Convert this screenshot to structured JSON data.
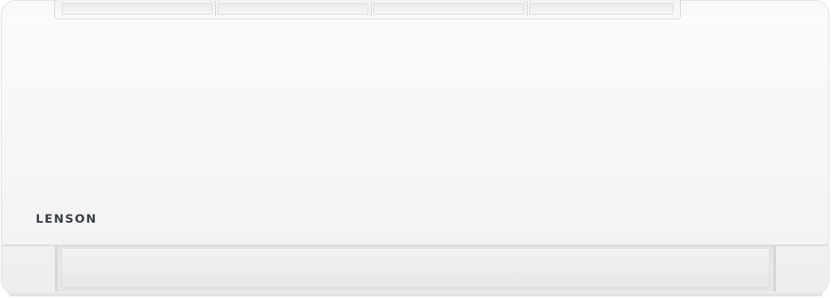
{
  "product": {
    "type": "wall-mounted split air conditioner indoor unit",
    "brand_logo_text": "LENSON",
    "colors": {
      "body": "#f6f6f6",
      "logo": "#3a3e47",
      "louver": "#ececec"
    }
  }
}
